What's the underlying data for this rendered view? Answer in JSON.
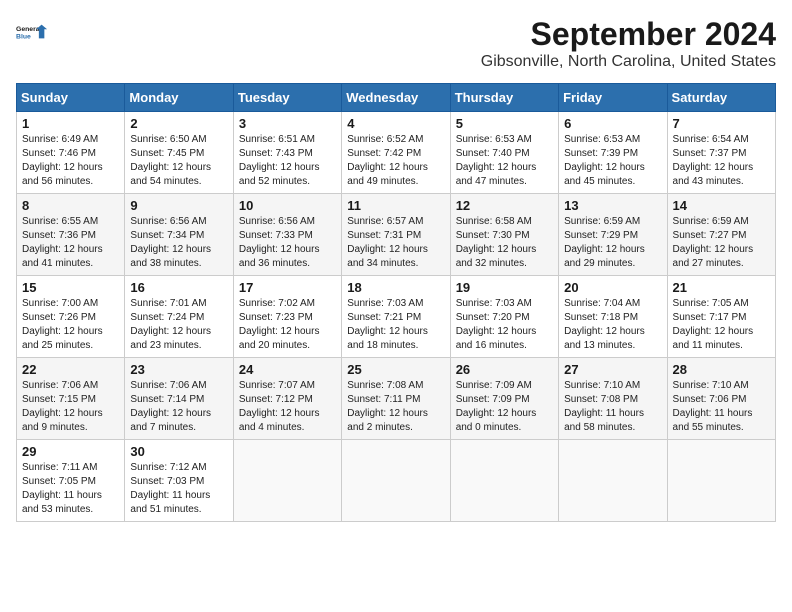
{
  "header": {
    "logo_line1": "General",
    "logo_line2": "Blue",
    "title": "September 2024",
    "subtitle": "Gibsonville, North Carolina, United States"
  },
  "days_of_week": [
    "Sunday",
    "Monday",
    "Tuesday",
    "Wednesday",
    "Thursday",
    "Friday",
    "Saturday"
  ],
  "weeks": [
    [
      {
        "day": "1",
        "info": "Sunrise: 6:49 AM\nSunset: 7:46 PM\nDaylight: 12 hours\nand 56 minutes."
      },
      {
        "day": "2",
        "info": "Sunrise: 6:50 AM\nSunset: 7:45 PM\nDaylight: 12 hours\nand 54 minutes."
      },
      {
        "day": "3",
        "info": "Sunrise: 6:51 AM\nSunset: 7:43 PM\nDaylight: 12 hours\nand 52 minutes."
      },
      {
        "day": "4",
        "info": "Sunrise: 6:52 AM\nSunset: 7:42 PM\nDaylight: 12 hours\nand 49 minutes."
      },
      {
        "day": "5",
        "info": "Sunrise: 6:53 AM\nSunset: 7:40 PM\nDaylight: 12 hours\nand 47 minutes."
      },
      {
        "day": "6",
        "info": "Sunrise: 6:53 AM\nSunset: 7:39 PM\nDaylight: 12 hours\nand 45 minutes."
      },
      {
        "day": "7",
        "info": "Sunrise: 6:54 AM\nSunset: 7:37 PM\nDaylight: 12 hours\nand 43 minutes."
      }
    ],
    [
      {
        "day": "8",
        "info": "Sunrise: 6:55 AM\nSunset: 7:36 PM\nDaylight: 12 hours\nand 41 minutes."
      },
      {
        "day": "9",
        "info": "Sunrise: 6:56 AM\nSunset: 7:34 PM\nDaylight: 12 hours\nand 38 minutes."
      },
      {
        "day": "10",
        "info": "Sunrise: 6:56 AM\nSunset: 7:33 PM\nDaylight: 12 hours\nand 36 minutes."
      },
      {
        "day": "11",
        "info": "Sunrise: 6:57 AM\nSunset: 7:31 PM\nDaylight: 12 hours\nand 34 minutes."
      },
      {
        "day": "12",
        "info": "Sunrise: 6:58 AM\nSunset: 7:30 PM\nDaylight: 12 hours\nand 32 minutes."
      },
      {
        "day": "13",
        "info": "Sunrise: 6:59 AM\nSunset: 7:29 PM\nDaylight: 12 hours\nand 29 minutes."
      },
      {
        "day": "14",
        "info": "Sunrise: 6:59 AM\nSunset: 7:27 PM\nDaylight: 12 hours\nand 27 minutes."
      }
    ],
    [
      {
        "day": "15",
        "info": "Sunrise: 7:00 AM\nSunset: 7:26 PM\nDaylight: 12 hours\nand 25 minutes."
      },
      {
        "day": "16",
        "info": "Sunrise: 7:01 AM\nSunset: 7:24 PM\nDaylight: 12 hours\nand 23 minutes."
      },
      {
        "day": "17",
        "info": "Sunrise: 7:02 AM\nSunset: 7:23 PM\nDaylight: 12 hours\nand 20 minutes."
      },
      {
        "day": "18",
        "info": "Sunrise: 7:03 AM\nSunset: 7:21 PM\nDaylight: 12 hours\nand 18 minutes."
      },
      {
        "day": "19",
        "info": "Sunrise: 7:03 AM\nSunset: 7:20 PM\nDaylight: 12 hours\nand 16 minutes."
      },
      {
        "day": "20",
        "info": "Sunrise: 7:04 AM\nSunset: 7:18 PM\nDaylight: 12 hours\nand 13 minutes."
      },
      {
        "day": "21",
        "info": "Sunrise: 7:05 AM\nSunset: 7:17 PM\nDaylight: 12 hours\nand 11 minutes."
      }
    ],
    [
      {
        "day": "22",
        "info": "Sunrise: 7:06 AM\nSunset: 7:15 PM\nDaylight: 12 hours\nand 9 minutes."
      },
      {
        "day": "23",
        "info": "Sunrise: 7:06 AM\nSunset: 7:14 PM\nDaylight: 12 hours\nand 7 minutes."
      },
      {
        "day": "24",
        "info": "Sunrise: 7:07 AM\nSunset: 7:12 PM\nDaylight: 12 hours\nand 4 minutes."
      },
      {
        "day": "25",
        "info": "Sunrise: 7:08 AM\nSunset: 7:11 PM\nDaylight: 12 hours\nand 2 minutes."
      },
      {
        "day": "26",
        "info": "Sunrise: 7:09 AM\nSunset: 7:09 PM\nDaylight: 12 hours\nand 0 minutes."
      },
      {
        "day": "27",
        "info": "Sunrise: 7:10 AM\nSunset: 7:08 PM\nDaylight: 11 hours\nand 58 minutes."
      },
      {
        "day": "28",
        "info": "Sunrise: 7:10 AM\nSunset: 7:06 PM\nDaylight: 11 hours\nand 55 minutes."
      }
    ],
    [
      {
        "day": "29",
        "info": "Sunrise: 7:11 AM\nSunset: 7:05 PM\nDaylight: 11 hours\nand 53 minutes."
      },
      {
        "day": "30",
        "info": "Sunrise: 7:12 AM\nSunset: 7:03 PM\nDaylight: 11 hours\nand 51 minutes."
      },
      {
        "day": "",
        "info": ""
      },
      {
        "day": "",
        "info": ""
      },
      {
        "day": "",
        "info": ""
      },
      {
        "day": "",
        "info": ""
      },
      {
        "day": "",
        "info": ""
      }
    ]
  ]
}
